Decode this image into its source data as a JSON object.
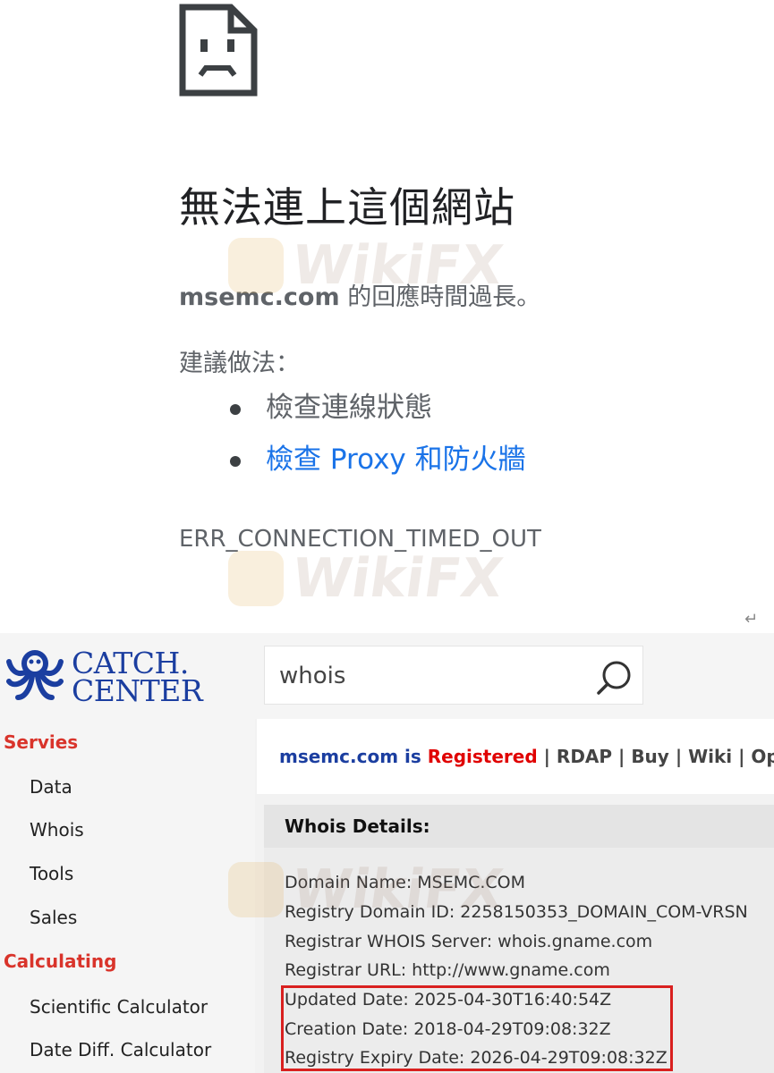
{
  "error_page": {
    "title": "無法連上這個網站",
    "domain": "msemc.com",
    "description_suffix": " 的回應時間過長。",
    "suggestions_heading": "建議做法：",
    "suggestions": [
      "檢查連線狀態",
      "檢查 Proxy 和防火牆"
    ],
    "error_code": "ERR_CONNECTION_TIMED_OUT",
    "return_glyph": "↵"
  },
  "watermark": {
    "text": "WikiFX"
  },
  "site": {
    "logo": {
      "line1": "CATCH.",
      "line2": "CENTER",
      "color": "#1b3ea0"
    },
    "search": {
      "value": "whois",
      "placeholder": ""
    },
    "sidebar": {
      "sections": [
        {
          "title": "Servies",
          "items": [
            "Data",
            "Whois",
            "Tools",
            "Sales"
          ]
        },
        {
          "title": "Calculating",
          "items": [
            "Scientific Calculator",
            "Date Diff. Calculator"
          ]
        }
      ]
    },
    "status": {
      "domain": "msemc.com",
      "is": "is",
      "registered": "Registered",
      "links": [
        "RDAP",
        "Buy",
        "Wiki",
        "Open"
      ],
      "separator": "|"
    },
    "whois": {
      "title": "Whois Details:",
      "records": [
        "Domain Name: MSEMC.COM",
        "Registry Domain ID: 2258150353_DOMAIN_COM-VRSN",
        "Registrar WHOIS Server: whois.gname.com",
        "Registrar URL: http://www.gname.com",
        "Updated Date: 2025-04-30T16:40:54Z",
        "Creation Date: 2018-04-29T09:08:32Z",
        "Registry Expiry Date: 2026-04-29T09:08:32Z"
      ]
    }
  },
  "colors": {
    "link_blue": "#1a73e8",
    "section_red": "#d9342b",
    "registered_red": "#e00000",
    "highlight_red": "#d9201f"
  }
}
